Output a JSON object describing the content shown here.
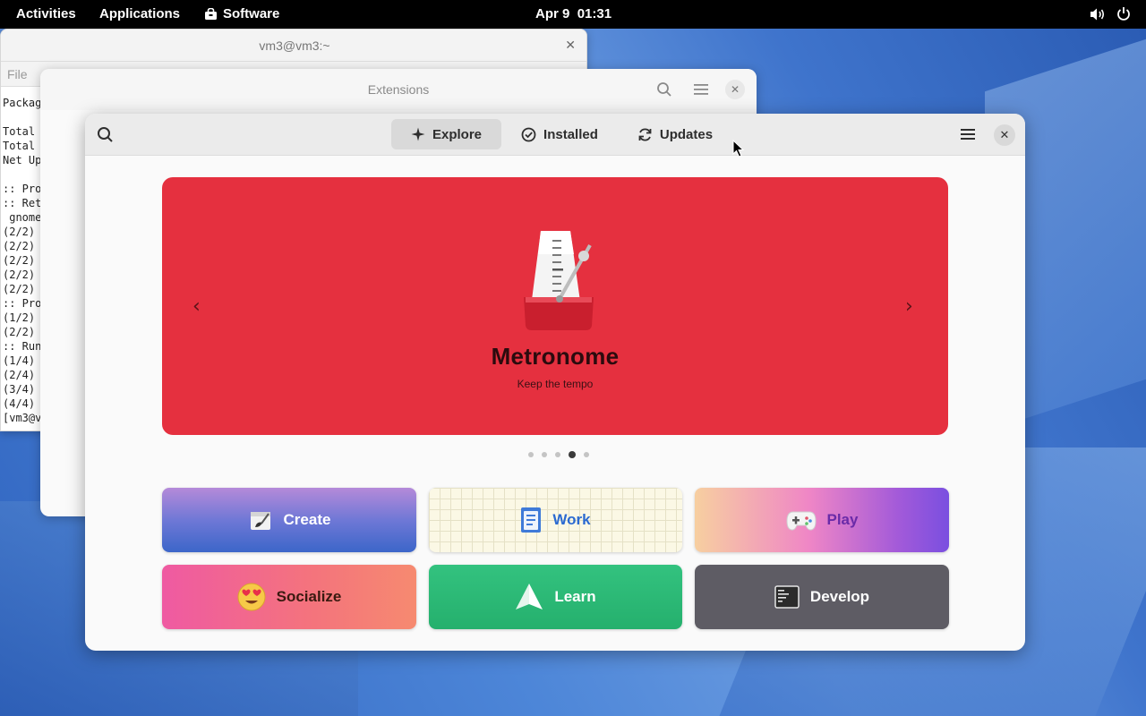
{
  "topbar": {
    "activities": "Activities",
    "applications": "Applications",
    "software": "Software",
    "date": "Apr 9",
    "time": "01:31"
  },
  "terminal": {
    "title": "vm3@vm3:~",
    "menu_file": "File",
    "lines": [
      "Packag",
      "",
      "Total ",
      "Total ",
      "Net Up",
      "",
      ":: Pro",
      ":: Ret",
      " gnome",
      "(2/2) ",
      "(2/2) ",
      "(2/2) ",
      "(2/2) ",
      "(2/2) ",
      ":: Pro",
      "(1/2) ",
      "(2/2) ",
      ":: Run",
      "(1/4) ",
      "(2/4) ",
      "(3/4) ",
      "(4/4) ",
      "[vm3@v"
    ]
  },
  "extensions": {
    "title": "Extensions"
  },
  "software": {
    "tabs": [
      {
        "label": "Explore",
        "icon": "sparkle-icon",
        "active": true
      },
      {
        "label": "Installed",
        "icon": "check-circle-icon",
        "active": false
      },
      {
        "label": "Updates",
        "icon": "refresh-icon",
        "active": false
      }
    ],
    "banner": {
      "app_name": "Metronome",
      "app_desc": "Keep the tempo",
      "color": "#e5303f",
      "page_count": 5,
      "active_page": 4
    },
    "categories": [
      {
        "label": "Create",
        "icon": "create-icon"
      },
      {
        "label": "Work",
        "icon": "work-icon"
      },
      {
        "label": "Play",
        "icon": "gamepad-icon"
      },
      {
        "label": "Socialize",
        "icon": "heart-eyes-icon"
      },
      {
        "label": "Learn",
        "icon": "paper-plane-icon"
      },
      {
        "label": "Develop",
        "icon": "terminal-icon"
      }
    ]
  }
}
